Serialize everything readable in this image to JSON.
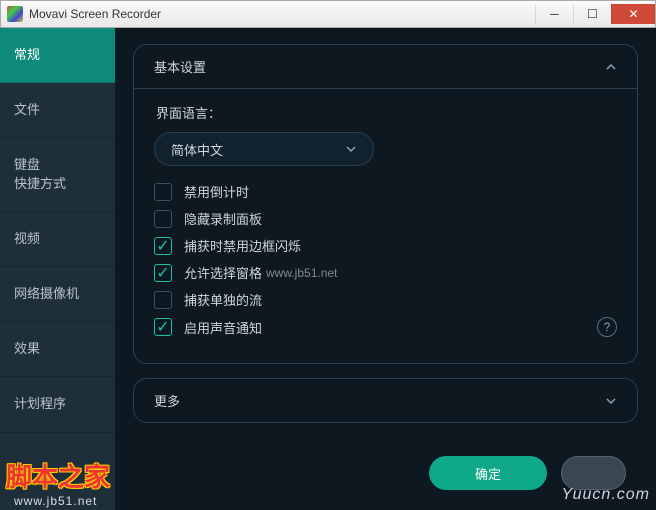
{
  "window": {
    "title": "Movavi Screen Recorder"
  },
  "sidebar": {
    "items": [
      {
        "label": "常规"
      },
      {
        "label": "文件"
      },
      {
        "label": "键盘\n快捷方式"
      },
      {
        "label": "视频"
      },
      {
        "label": "网络摄像机"
      },
      {
        "label": "效果"
      },
      {
        "label": "计划程序"
      }
    ]
  },
  "panel_basic": {
    "title": "基本设置",
    "lang_label": "界面语言：",
    "lang_value": "简体中文",
    "options": [
      {
        "label": "禁用倒计时",
        "checked": false
      },
      {
        "label": "隐藏录制面板",
        "checked": false
      },
      {
        "label": "捕获时禁用边框闪烁",
        "checked": true
      },
      {
        "label": "允许选择窗格",
        "checked": true,
        "wm": "www.jb51.net"
      },
      {
        "label": "捕获单独的流",
        "checked": false
      },
      {
        "label": "启用声音通知",
        "checked": true,
        "help": true
      }
    ]
  },
  "panel_more": {
    "title": "更多"
  },
  "footer": {
    "ok": "确定"
  },
  "watermarks": {
    "logo": "脚本之家",
    "url": "www.jb51.net",
    "right": "Yuucn.com"
  }
}
